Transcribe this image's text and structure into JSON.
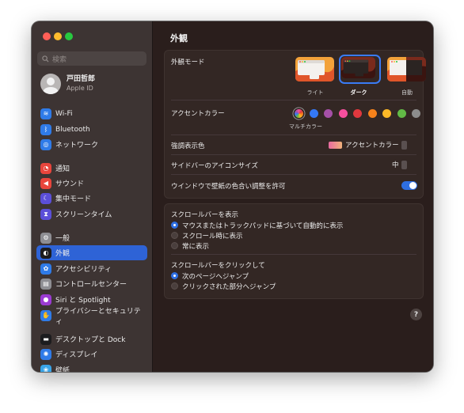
{
  "search": {
    "placeholder": "検索"
  },
  "user": {
    "name": "戸田哲郎",
    "subtitle": "Apple ID"
  },
  "sidebar": {
    "items": [
      {
        "label": "Wi-Fi",
        "icon": "wifi-icon",
        "color": "#2f7be8"
      },
      {
        "label": "Bluetooth",
        "icon": "bluetooth-icon",
        "color": "#2f7be8"
      },
      {
        "label": "ネットワーク",
        "icon": "globe-icon",
        "color": "#2f7be8"
      },
      {
        "label": "通知",
        "icon": "bell-icon",
        "color": "#e8453c"
      },
      {
        "label": "サウンド",
        "icon": "speaker-icon",
        "color": "#e8453c"
      },
      {
        "label": "集中モード",
        "icon": "moon-icon",
        "color": "#5b4fd8"
      },
      {
        "label": "スクリーンタイム",
        "icon": "hourglass-icon",
        "color": "#5b4fd8"
      },
      {
        "label": "一般",
        "icon": "gear-icon",
        "color": "#8e8e93"
      },
      {
        "label": "外観",
        "icon": "appearance-icon",
        "color": "#1c1c1e",
        "active": true
      },
      {
        "label": "アクセシビリティ",
        "icon": "accessibility-icon",
        "color": "#2f7be8"
      },
      {
        "label": "コントロールセンター",
        "icon": "control-center-icon",
        "color": "#8e8e93"
      },
      {
        "label": "Siri と Spotlight",
        "icon": "siri-icon",
        "color": "#9b3bd1"
      },
      {
        "label": "プライバシーとセキュリティ",
        "icon": "hand-icon",
        "color": "#2f7be8"
      },
      {
        "label": "デスクトップと Dock",
        "icon": "dock-icon",
        "color": "#1c1c1e"
      },
      {
        "label": "ディスプレイ",
        "icon": "sun-icon",
        "color": "#2f7be8"
      },
      {
        "label": "壁紙",
        "icon": "wallpaper-icon",
        "color": "#39a4e8"
      }
    ]
  },
  "main": {
    "title": "外観",
    "appearance": {
      "label": "外観モード",
      "options": [
        {
          "label": "ライト",
          "selected": false
        },
        {
          "label": "ダーク",
          "selected": true
        },
        {
          "label": "自動",
          "selected": false
        }
      ]
    },
    "accent": {
      "label": "アクセントカラー",
      "caption": "マルチカラー",
      "colors": [
        "multicolor",
        "#3478f6",
        "#a550a7",
        "#f74f9e",
        "#e0383e",
        "#f7821b",
        "#fcb827",
        "#62ba46",
        "#8c8c8c"
      ]
    },
    "highlight": {
      "label": "強調表示色",
      "value": "アクセントカラー"
    },
    "sidebar_icon_size": {
      "label": "サイドバーのアイコンサイズ",
      "value": "中"
    },
    "tinting": {
      "label": "ウインドウで壁紙の色合い調整を許可",
      "enabled": true
    },
    "scrollbars": {
      "label": "スクロールバーを表示",
      "options": [
        {
          "label": "マウスまたはトラックパッドに基づいて自動的に表示",
          "selected": true
        },
        {
          "label": "スクロール時に表示",
          "selected": false
        },
        {
          "label": "常に表示",
          "selected": false
        }
      ]
    },
    "click": {
      "label": "スクロールバーをクリックして",
      "options": [
        {
          "label": "次のページへジャンプ",
          "selected": true
        },
        {
          "label": "クリックされた部分へジャンプ",
          "selected": false
        }
      ]
    },
    "help_label": "?"
  }
}
